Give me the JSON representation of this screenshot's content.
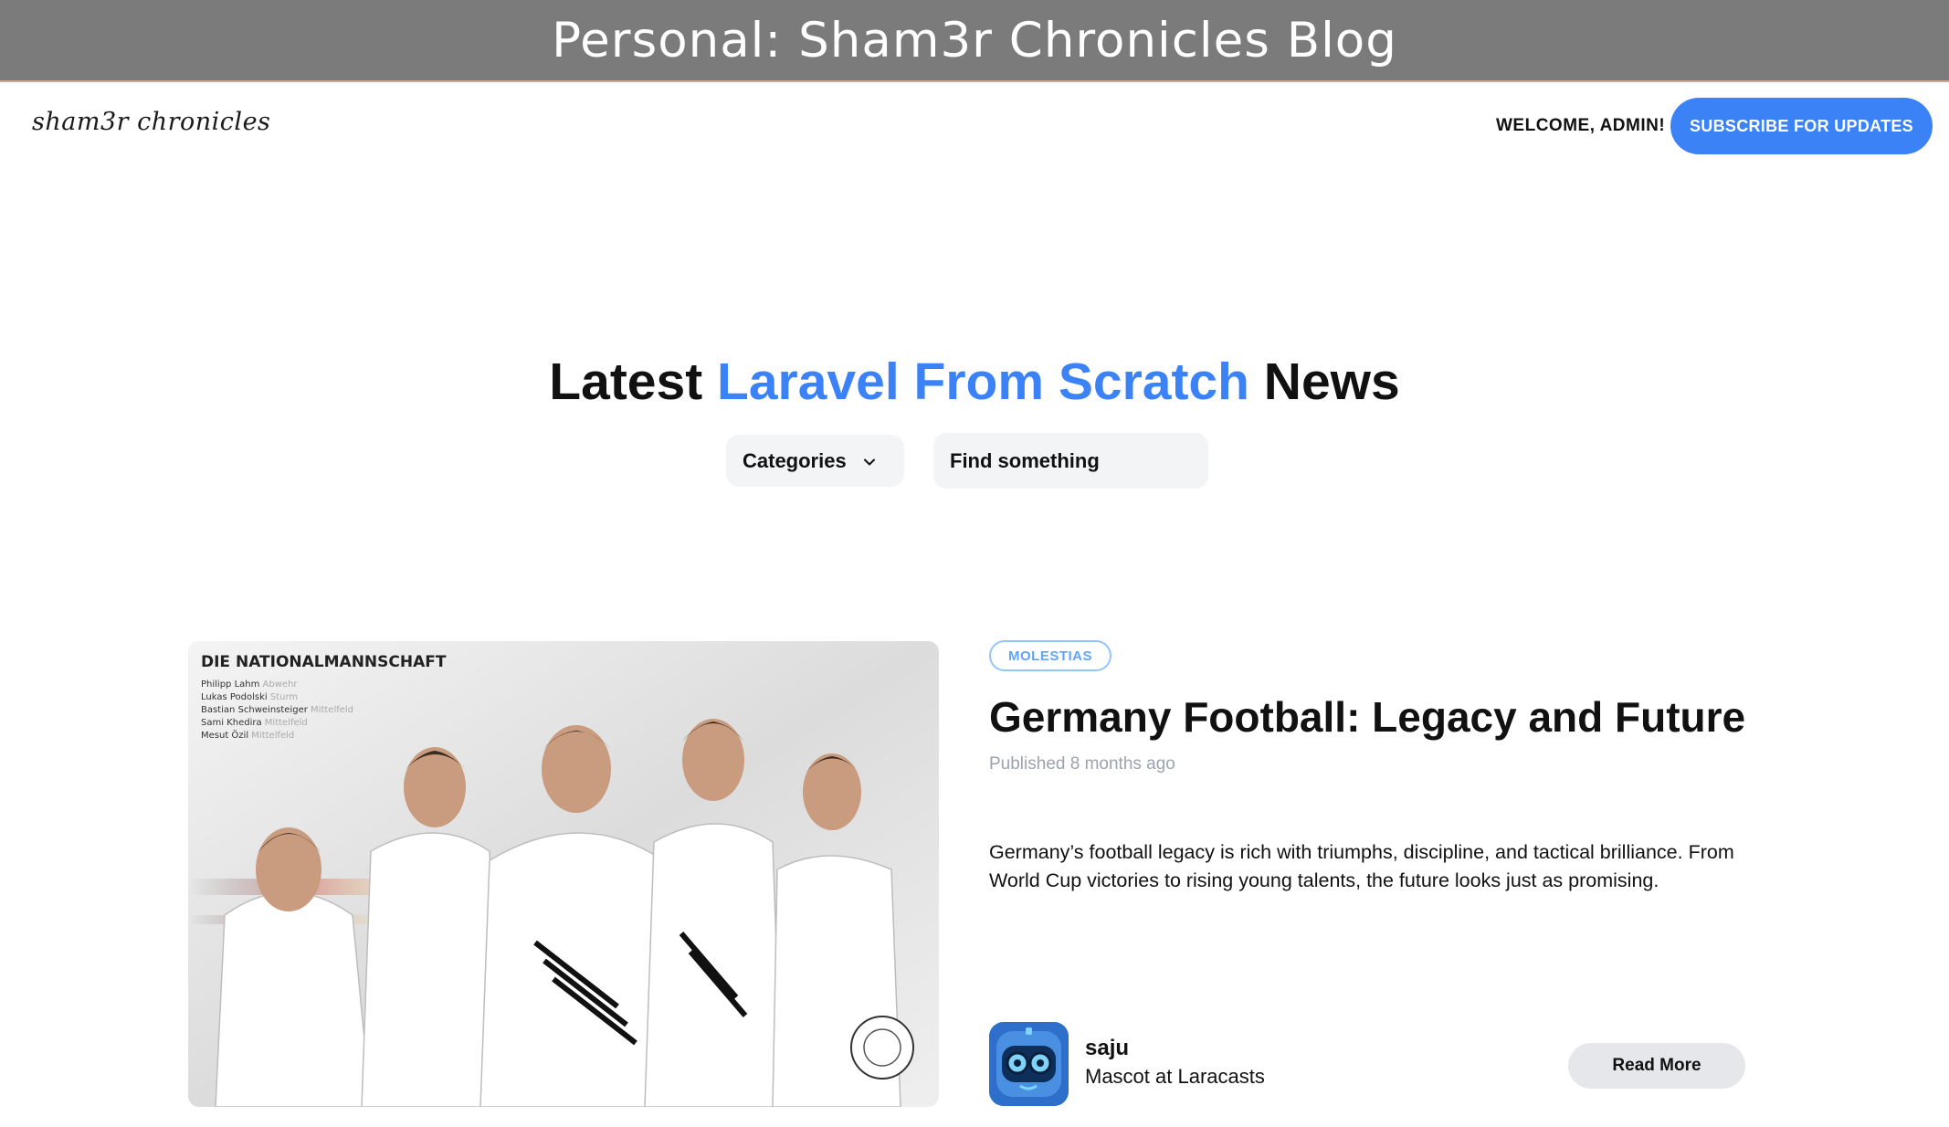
{
  "window": {
    "title": "Personal: Sham3r Chronicles Blog"
  },
  "nav": {
    "logo": "sham3r chronicles",
    "welcome": "WELCOME, ADMIN!",
    "subscribe_label": "SUBSCRIBE FOR UPDATES"
  },
  "hero": {
    "headline_prefix": "Latest ",
    "headline_accent": "Laravel From Scratch",
    "headline_suffix": " News",
    "categories_label": "Categories",
    "search_placeholder": "Find something"
  },
  "post": {
    "category": "MOLESTIAS",
    "title": "Germany Football: Legacy and Future",
    "published_prefix": "Published ",
    "published_ago": "8 months ago",
    "excerpt": "Germany’s football legacy is rich with triumphs, discipline, and tactical brilliance. From World Cup victories to rising young talents, the future looks just as promising.",
    "author": {
      "name": "saju",
      "role": "Mascot at Laracasts"
    },
    "read_more_label": "Read More",
    "image": {
      "heading": "DIE NATIONALMANNSCHAFT",
      "players": [
        {
          "name": "Philipp Lahm",
          "position": "Abwehr"
        },
        {
          "name": "Lukas Podolski",
          "position": "Sturm"
        },
        {
          "name": "Bastian Schweinsteiger",
          "position": "Mittelfeld"
        },
        {
          "name": "Sami Khedira",
          "position": "Mittelfeld"
        },
        {
          "name": "Mesut Özil",
          "position": "Mittelfeld"
        }
      ]
    }
  },
  "colors": {
    "accent": "#3b82f6",
    "title_strip": "#7b7b7b",
    "badge_border": "#93c5fd",
    "muted_text": "#9ca3af"
  }
}
